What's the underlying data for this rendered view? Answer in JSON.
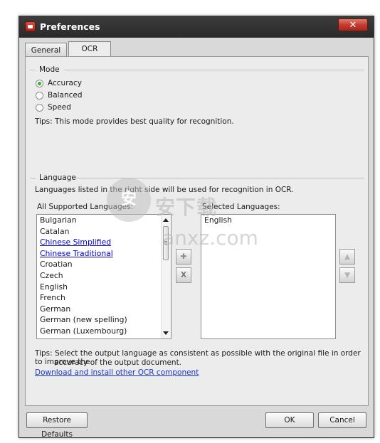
{
  "window": {
    "title": "Preferences",
    "close_glyph": "✕"
  },
  "tabs": [
    {
      "label": "General",
      "selected": false
    },
    {
      "label": "OCR",
      "selected": true
    }
  ],
  "mode": {
    "heading": "Mode",
    "options": [
      {
        "label": "Accuracy",
        "checked": true
      },
      {
        "label": "Balanced",
        "checked": false
      },
      {
        "label": "Speed",
        "checked": false
      }
    ],
    "tips": "Tips:  This mode provides best quality for recognition."
  },
  "language": {
    "heading": "Language",
    "description": "Languages listed in the right side will be used for recognition in OCR.",
    "all_label": "All Supported Languages:",
    "selected_label": "Selected Languages:",
    "all_languages": [
      {
        "label": "Bulgarian"
      },
      {
        "label": "Catalan"
      },
      {
        "label": "Chinese Simplified",
        "link": true
      },
      {
        "label": "Chinese Traditional",
        "link": true
      },
      {
        "label": "Croatian"
      },
      {
        "label": "Czech"
      },
      {
        "label": "English"
      },
      {
        "label": "French"
      },
      {
        "label": "German"
      },
      {
        "label": "German (new spelling)"
      },
      {
        "label": "German (Luxembourg)"
      }
    ],
    "selected_languages": [
      "English"
    ],
    "tips_line1": "Tips:  Select the output language as consistent as possible with the original file in order to improve the",
    "tips_line2": "accuracy of the output document.",
    "download_link": "Download and install other OCR component"
  },
  "buttons": {
    "add_glyph": "✚",
    "remove_glyph": "X",
    "up_glyph": "▲",
    "down_glyph": "▼"
  },
  "footer": {
    "restore_defaults": "Restore Defaults",
    "ok": "OK",
    "cancel": "Cancel"
  },
  "watermark": {
    "icon_glyph": "安",
    "line1": "安下载",
    "line2": "anxz.com"
  },
  "colors": {
    "titlebar": "#2f2f2f",
    "close_button": "#c0392b",
    "radio_checked": "#2db52d",
    "link": "#1a38c8"
  }
}
